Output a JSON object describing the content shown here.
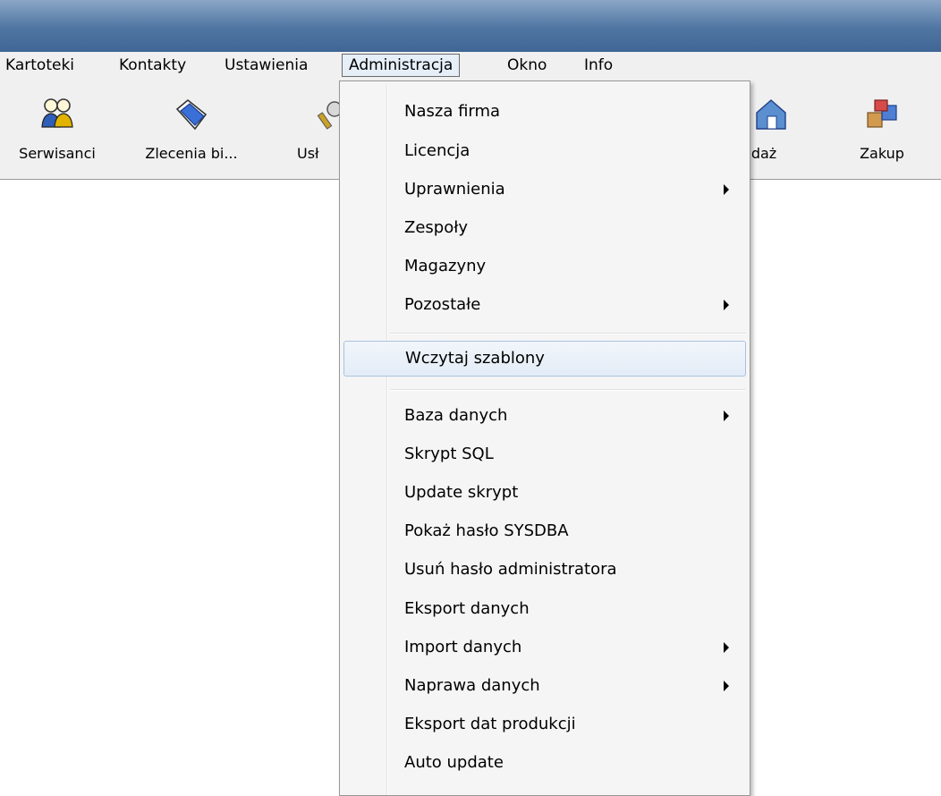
{
  "menubar": {
    "items": [
      "Kartoteki",
      "Kontakty",
      "Ustawienia",
      "Administracja",
      "Okno",
      "Info"
    ]
  },
  "toolbar": {
    "buttons": [
      {
        "label": "Serwisanci",
        "icon": "users-icon"
      },
      {
        "label": "Zlecenia bi...",
        "icon": "folder-icon"
      },
      {
        "label": "Usł",
        "icon": "tools-icon"
      },
      {
        "label": "edaż",
        "icon": "house-icon"
      },
      {
        "label": "Zakup",
        "icon": "boxes-icon"
      }
    ]
  },
  "dropdown": {
    "items": [
      {
        "label": "Nasza firma"
      },
      {
        "label": "Licencja"
      },
      {
        "label": "Uprawnienia",
        "submenu": true
      },
      {
        "label": "Zespoły"
      },
      {
        "label": "Magazyny"
      },
      {
        "label": "Pozostałe",
        "submenu": true
      },
      {
        "label": "Wczytaj szablony",
        "highlighted": true
      },
      {
        "label": "Baza danych",
        "submenu": true
      },
      {
        "label": "Skrypt SQL"
      },
      {
        "label": "Update skrypt"
      },
      {
        "label": "Pokaż hasło SYSDBA"
      },
      {
        "label": "Usuń hasło administratora"
      },
      {
        "label": "Eksport danych"
      },
      {
        "label": "Import danych",
        "submenu": true
      },
      {
        "label": "Naprawa danych",
        "submenu": true
      },
      {
        "label": "Eksport dat produkcji"
      },
      {
        "label": "Auto update"
      }
    ]
  },
  "colors": {
    "titlebar": "#4f75a2",
    "highlight_border": "#a8c2e0",
    "menu_bg": "#f5f5f5"
  }
}
